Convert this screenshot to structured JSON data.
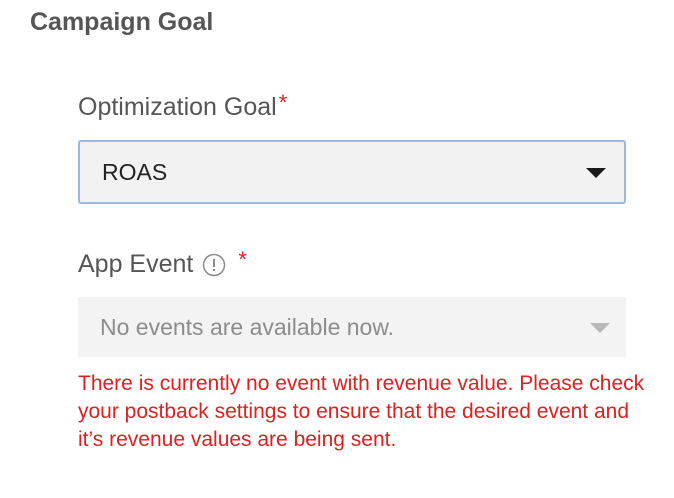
{
  "section": {
    "title": "Campaign Goal"
  },
  "optimization_goal": {
    "label": "Optimization Goal",
    "required_marker": "*",
    "selected_value": "ROAS"
  },
  "app_event": {
    "label": "App Event",
    "info_icon": "info-circle-icon",
    "required_marker": "*",
    "placeholder": "No events are available now.",
    "error_message": "There is currently no event with revenue value. Please check your postback settings to ensure that the desired event and it’s revenue values are being sent."
  },
  "colors": {
    "label_text": "#555555",
    "required": "#e02020",
    "error": "#e02020",
    "focus_border": "#9cb8e3",
    "disabled_bg": "#f3f3f3"
  }
}
